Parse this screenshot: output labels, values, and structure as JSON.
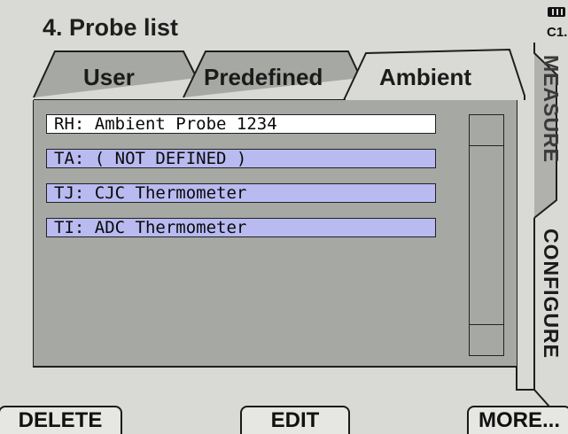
{
  "header": {
    "title": "4. Probe list",
    "channel": "C1."
  },
  "tabs": [
    {
      "label": "User",
      "active": false
    },
    {
      "label": "Predefined",
      "active": false
    },
    {
      "label": "Ambient",
      "active": true
    }
  ],
  "probes": [
    {
      "text": "RH: Ambient Probe 1234",
      "selected": true
    },
    {
      "text": "TA: ( NOT DEFINED )",
      "selected": false
    },
    {
      "text": "TJ: CJC Thermometer",
      "selected": false
    },
    {
      "text": "TI: ADC Thermometer",
      "selected": false
    }
  ],
  "side_tabs": {
    "measure": "MEASURE",
    "configure": "CONFIGURE"
  },
  "softkeys": {
    "delete": "DELETE",
    "edit": "EDIT",
    "more": "MORE..."
  },
  "colors": {
    "background": "#d9d9d6",
    "panel": "#a6a8a3",
    "row_highlight": "#b8baf0",
    "row_selected": "#ffffff",
    "ink": "#1b1b1b"
  }
}
